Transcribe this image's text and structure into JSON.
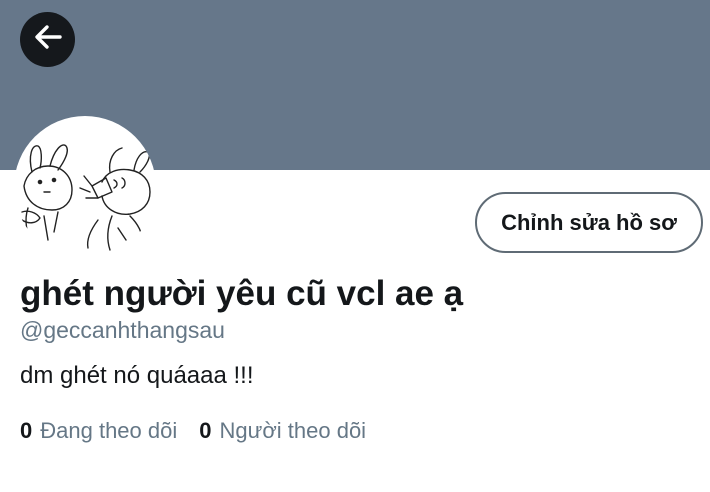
{
  "profile": {
    "display_name": "ghét người yêu cũ vcl ae ạ",
    "handle": "@geccanhthangsau",
    "bio": "dm ghét nó quáaaa !!!",
    "edit_profile_label": "Chỉnh sửa hồ sơ",
    "following_count": "0",
    "following_label": "Đang theo dõi",
    "followers_count": "0",
    "followers_label": "Người theo dõi"
  },
  "header": {
    "back_icon": "arrow-left-icon"
  },
  "colors": {
    "banner": "#66778a",
    "text_primary": "#14171a",
    "text_secondary": "#657786",
    "back_button_bg": "#15181c"
  }
}
